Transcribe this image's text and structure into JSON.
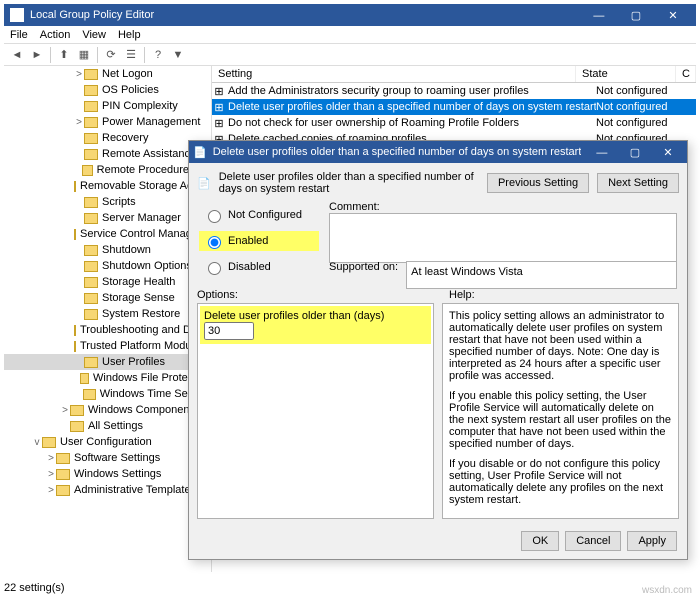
{
  "window": {
    "title": "Local Group Policy Editor",
    "controls": {
      "min": "—",
      "max": "▢",
      "close": "✕"
    }
  },
  "menu": [
    "File",
    "Action",
    "View",
    "Help"
  ],
  "toolbar_icons": [
    "back",
    "fwd",
    "up",
    "grid",
    "refresh",
    "list",
    "help",
    "filter"
  ],
  "tree": [
    {
      "depth": 3,
      "tw": ">",
      "label": "Net Logon"
    },
    {
      "depth": 3,
      "tw": "",
      "label": "OS Policies"
    },
    {
      "depth": 3,
      "tw": "",
      "label": "PIN Complexity"
    },
    {
      "depth": 3,
      "tw": ">",
      "label": "Power Management"
    },
    {
      "depth": 3,
      "tw": "",
      "label": "Recovery"
    },
    {
      "depth": 3,
      "tw": "",
      "label": "Remote Assistance"
    },
    {
      "depth": 3,
      "tw": "",
      "label": "Remote Procedure Call"
    },
    {
      "depth": 3,
      "tw": "",
      "label": "Removable Storage Access"
    },
    {
      "depth": 3,
      "tw": "",
      "label": "Scripts"
    },
    {
      "depth": 3,
      "tw": "",
      "label": "Server Manager"
    },
    {
      "depth": 3,
      "tw": "",
      "label": "Service Control Manager Settin"
    },
    {
      "depth": 3,
      "tw": "",
      "label": "Shutdown"
    },
    {
      "depth": 3,
      "tw": "",
      "label": "Shutdown Options"
    },
    {
      "depth": 3,
      "tw": "",
      "label": "Storage Health"
    },
    {
      "depth": 3,
      "tw": "",
      "label": "Storage Sense"
    },
    {
      "depth": 3,
      "tw": "",
      "label": "System Restore"
    },
    {
      "depth": 3,
      "tw": "",
      "label": "Troubleshooting and Diagnostic"
    },
    {
      "depth": 3,
      "tw": "",
      "label": "Trusted Platform Module Servi"
    },
    {
      "depth": 3,
      "tw": "",
      "label": "User Profiles",
      "selected": true
    },
    {
      "depth": 3,
      "tw": "",
      "label": "Windows File Protection"
    },
    {
      "depth": 3,
      "tw": "",
      "label": "Windows Time Service"
    },
    {
      "depth": 2,
      "tw": ">",
      "label": "Windows Components"
    },
    {
      "depth": 2,
      "tw": "",
      "label": "All Settings"
    },
    {
      "depth": 0,
      "tw": "v",
      "label": "User Configuration",
      "icon": "cfg"
    },
    {
      "depth": 1,
      "tw": ">",
      "label": "Software Settings"
    },
    {
      "depth": 1,
      "tw": ">",
      "label": "Windows Settings"
    },
    {
      "depth": 1,
      "tw": ">",
      "label": "Administrative Templates"
    }
  ],
  "list": {
    "columns": [
      "Setting",
      "State",
      "C"
    ],
    "rows": [
      {
        "name": "Add the Administrators security group to roaming user profiles",
        "state": "Not configured"
      },
      {
        "name": "Delete user profiles older than a specified number of days on system restart",
        "state": "Not configured",
        "selected": true
      },
      {
        "name": "Do not check for user ownership of Roaming Profile Folders",
        "state": "Not configured"
      },
      {
        "name": "Delete cached copies of roaming profiles",
        "state": "Not configured"
      }
    ]
  },
  "status": "22 setting(s)",
  "dialog": {
    "title": "Delete user profiles older than a specified number of days on system restart",
    "policy_name": "Delete user profiles older than a specified number of days on system restart",
    "prev": "Previous Setting",
    "next": "Next Setting",
    "radio": {
      "not_configured": "Not Configured",
      "enabled": "Enabled",
      "disabled": "Disabled",
      "selected": "enabled"
    },
    "comment_label": "Comment:",
    "supported_label": "Supported on:",
    "supported_value": "At least Windows Vista",
    "options_label": "Options:",
    "help_label": "Help:",
    "option_text": "Delete user profiles older than (days)",
    "option_value": "30",
    "help_paragraphs": [
      "This policy setting allows an administrator to automatically delete user profiles on system restart that have not been used within a specified number of days. Note: One day is interpreted as 24 hours after a specific user profile was accessed.",
      "If you enable this policy setting, the User Profile Service will automatically delete on the next system restart all user profiles on the computer that have not been used within the specified number of days.",
      "If you disable or do not configure this policy setting, User Profile Service will not automatically delete any profiles on the next system restart."
    ],
    "buttons": {
      "ok": "OK",
      "cancel": "Cancel",
      "apply": "Apply"
    }
  },
  "watermark": "wsxdn.com"
}
